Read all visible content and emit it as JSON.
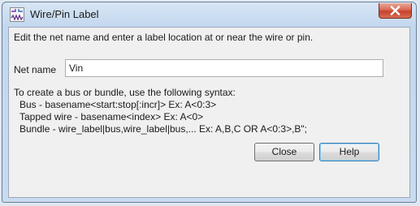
{
  "window": {
    "title": "Wire/Pin Label",
    "icon": "wire-pin-app-icon",
    "close_icon": "close-x-icon"
  },
  "dialog": {
    "instruction": "Edit the net name and enter a label location at or near the wire or pin.",
    "net_name_label": "Net name",
    "net_name_value": "Vin",
    "syntax_title": "To create a bus or bundle, use the following syntax:",
    "syntax_lines": [
      "Bus - basename<start:stop[:incr]> Ex: A<0:3>",
      "Tapped wire - basename<index> Ex: A<0>",
      "Bundle - wire_label|bus,wire_label|bus,... Ex: A,B,C OR A<0:3>,B\";"
    ]
  },
  "buttons": {
    "close_label": "Close",
    "help_label": "Help"
  },
  "colors": {
    "titlebar": "#c3d7ee",
    "close_button": "#c8402a",
    "client_background": "#f0f0f0"
  }
}
